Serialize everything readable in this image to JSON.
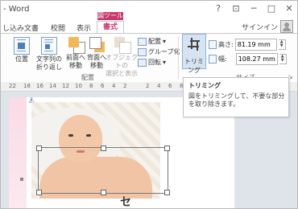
{
  "window": {
    "title": "- Word",
    "context_group": "図ツール",
    "controls": [
      "?",
      "⊡",
      "─",
      "□",
      "✕"
    ]
  },
  "tabs": {
    "items": [
      "し込み文書",
      "校閲",
      "表示",
      "書式"
    ],
    "active": "書式"
  },
  "account": {
    "signin_label": "サインイン"
  },
  "ribbon": {
    "arrange": {
      "position_label": "位置",
      "wrap_label": "文字列の\n折り返し",
      "forward_label": "前面へ\n移動",
      "backward_label": "背面へ\n移動",
      "selection_pane_label": "オブジェクトの\n選択と表示",
      "align_label": "配置",
      "group_label": "グループ化",
      "rotate_label": "回転",
      "group_name": "配置"
    },
    "size": {
      "crop_label": "トリミング",
      "height_label": "高さ:",
      "height_value": "81.19 mm",
      "width_label": "幅:",
      "width_value": "108.27 mm",
      "group_name": "サイズ"
    }
  },
  "ruler": {
    "numbers": [
      "22",
      "18",
      "16",
      "14",
      "12",
      "10",
      "8",
      "6",
      "4",
      "2",
      "",
      "2",
      "4",
      "6",
      "8",
      "10",
      "12",
      "14",
      "16",
      "18"
    ]
  },
  "document": {
    "visible_char": "セ"
  },
  "tooltip": {
    "title": "トリミング",
    "body": "図をトリミングして、不要な部分を取り除きます。"
  }
}
